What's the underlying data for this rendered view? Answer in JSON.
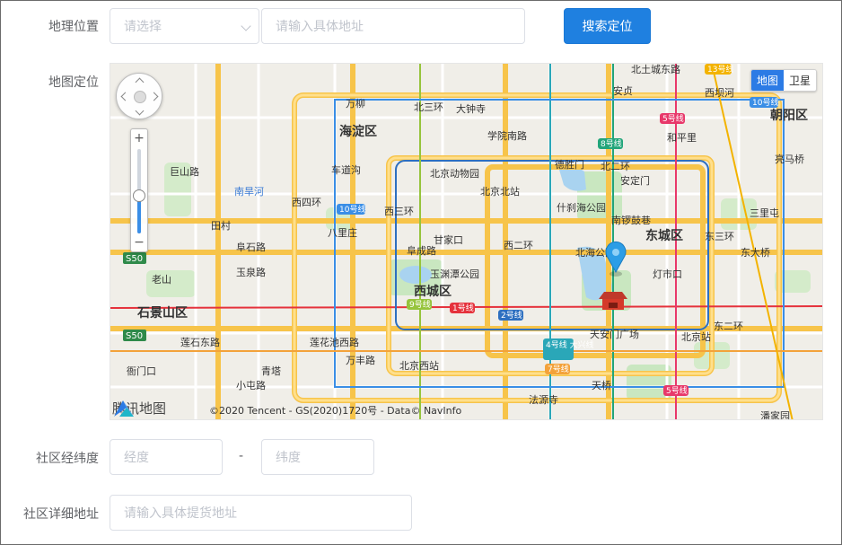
{
  "form": {
    "location_label": "地理位置",
    "province_select_placeholder": "请选择",
    "address_placeholder": "请输入具体地址",
    "search_button": "搜索定位",
    "map_label": "地图定位",
    "latlng_label": "社区经纬度",
    "longitude_placeholder": "经度",
    "separator": "-",
    "latitude_placeholder": "纬度",
    "detail_label": "社区详细地址",
    "detail_placeholder": "请输入具体提货地址"
  },
  "map": {
    "toggle_map": "地图",
    "toggle_satellite": "卫星",
    "zoom_plus": "+",
    "zoom_minus": "−",
    "zoom_level_fraction": 0.45,
    "copyright": "©2020 Tencent - GS(2020)1720号 - Data© NavInfo",
    "logo_text": "腾讯地图",
    "places": [
      {
        "name": "北土城东路",
        "cls": "road"
      },
      {
        "name": "西坝河",
        "cls": "poi"
      },
      {
        "name": "朝阳区",
        "cls": "district"
      },
      {
        "name": "万柳",
        "cls": "poi"
      },
      {
        "name": "北三环",
        "cls": "road"
      },
      {
        "name": "大钟寺",
        "cls": "poi"
      },
      {
        "name": "安贞",
        "cls": "poi"
      },
      {
        "name": "海淀区",
        "cls": "district"
      },
      {
        "name": "学院南路",
        "cls": "road"
      },
      {
        "name": "和平里",
        "cls": "poi"
      },
      {
        "name": "德胜门",
        "cls": "poi"
      },
      {
        "name": "北二环",
        "cls": "road"
      },
      {
        "name": "车道沟",
        "cls": "poi"
      },
      {
        "name": "北京动物园",
        "cls": "poi"
      },
      {
        "name": "北京北站",
        "cls": "poi"
      },
      {
        "name": "安定门",
        "cls": "poi"
      },
      {
        "name": "亮马桥",
        "cls": "poi"
      },
      {
        "name": "南旱河",
        "cls": "water"
      },
      {
        "name": "什刹海公园",
        "cls": "poi"
      },
      {
        "name": "南锣鼓巷",
        "cls": "poi"
      },
      {
        "name": "三里屯",
        "cls": "poi"
      },
      {
        "name": "田村",
        "cls": "poi"
      },
      {
        "name": "西四环",
        "cls": "road"
      },
      {
        "name": "八里庄",
        "cls": "poi"
      },
      {
        "name": "西三环",
        "cls": "road"
      },
      {
        "name": "甘家口",
        "cls": "poi"
      },
      {
        "name": "东城区",
        "cls": "district"
      },
      {
        "name": "阜石路",
        "cls": "road"
      },
      {
        "name": "阜成路",
        "cls": "road"
      },
      {
        "name": "北海公园",
        "cls": "poi"
      },
      {
        "name": "东大桥",
        "cls": "poi"
      },
      {
        "name": "东三环",
        "cls": "road"
      },
      {
        "name": "老山",
        "cls": "poi"
      },
      {
        "name": "玉渊潭公园",
        "cls": "poi"
      },
      {
        "name": "西二环",
        "cls": "road"
      },
      {
        "name": "灯市口",
        "cls": "poi"
      },
      {
        "name": "西城区",
        "cls": "district"
      },
      {
        "name": "玉泉路",
        "cls": "road"
      },
      {
        "name": "石景山区",
        "cls": "district"
      },
      {
        "name": "天安门广场",
        "cls": "poi"
      },
      {
        "name": "北京站",
        "cls": "poi"
      },
      {
        "name": "东二环",
        "cls": "road"
      },
      {
        "name": "莲石东路",
        "cls": "road"
      },
      {
        "name": "莲花池西路",
        "cls": "road"
      },
      {
        "name": "北京西站",
        "cls": "poi"
      },
      {
        "name": "衙门口",
        "cls": "poi"
      },
      {
        "name": "青塔",
        "cls": "poi"
      },
      {
        "name": "万丰路",
        "cls": "road"
      },
      {
        "name": "法源寺",
        "cls": "poi"
      },
      {
        "name": "天桥",
        "cls": "poi"
      },
      {
        "name": "潘家园",
        "cls": "poi"
      },
      {
        "name": "巨山路",
        "cls": "road"
      },
      {
        "name": "小屯路",
        "cls": "road"
      },
      {
        "name": "S50",
        "cls": "shield"
      },
      {
        "name": "S50",
        "cls": "shield"
      }
    ],
    "metro": [
      {
        "name": "13号线",
        "color": "#f3b300"
      },
      {
        "name": "10号线",
        "color": "#3a8ee6"
      },
      {
        "name": "5号线",
        "color": "#e8386a"
      },
      {
        "name": "8号线",
        "color": "#22a57a"
      },
      {
        "name": "10号线",
        "color": "#3a8ee6"
      },
      {
        "name": "9号线",
        "color": "#96c43c"
      },
      {
        "name": "1号线",
        "color": "#e5323c"
      },
      {
        "name": "2号线",
        "color": "#2d6fc0"
      },
      {
        "name": "4号线 大兴线",
        "color": "#2aa7b8"
      },
      {
        "name": "7号线",
        "color": "#f3a23a"
      },
      {
        "name": "5号线",
        "color": "#e8386a"
      }
    ]
  }
}
